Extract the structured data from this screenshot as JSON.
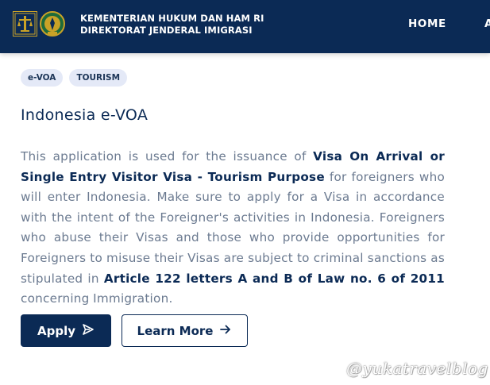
{
  "header": {
    "org_line1": "KEMENTERIAN HUKUM DAN HAM RI",
    "org_line2": "DIREKTORAT JENDERAL IMIGRASI",
    "nav": [
      {
        "label": "HOME"
      },
      {
        "label": "A"
      }
    ]
  },
  "tags": [
    "e-VOA",
    "TOURISM"
  ],
  "title": "Indonesia e-VOA",
  "description": {
    "part1": "This application is used for the issuance of ",
    "bold1": "Visa On Arrival or Single Entry Visitor Visa - Tourism Purpose",
    "part2": " for foreigners who will enter Indonesia. Make sure to apply for a Visa in accordance with the intent of the Foreigner's activities in Indonesia. Foreigners who abuse their Visas and those who provide opportunities for Foreigners to misuse their Visas are subject to criminal sanctions as stipulated in ",
    "bold2": "Article 122 letters A and B of Law no. 6 of 2011",
    "part3": " concerning Immigration."
  },
  "buttons": {
    "apply": "Apply",
    "apply_icon": "send-icon",
    "learn_more": "Learn More",
    "learn_more_icon": "arrow-right-icon"
  },
  "watermark": "@yukatravelblog",
  "colors": {
    "navy": "#0b2a55",
    "tag_bg": "#e4e9f7",
    "body_text": "#6b7a90",
    "logo_gold": "#c9a227"
  }
}
